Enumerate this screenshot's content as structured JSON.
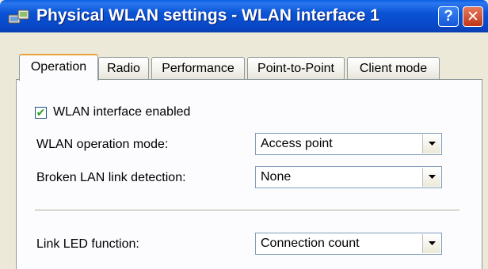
{
  "window": {
    "title": "Physical WLAN settings - WLAN interface 1",
    "help_label": "?",
    "close_label": "✕"
  },
  "tabs": [
    {
      "label": "Operation",
      "active": true
    },
    {
      "label": "Radio",
      "active": false
    },
    {
      "label": "Performance",
      "active": false
    },
    {
      "label": "Point-to-Point",
      "active": false
    },
    {
      "label": "Client mode",
      "active": false
    }
  ],
  "operation": {
    "wlan_enabled": {
      "label": "WLAN interface enabled",
      "checked": true,
      "mark": "✔"
    },
    "operation_mode": {
      "label": "WLAN operation mode:",
      "value": "Access point"
    },
    "broken_link": {
      "label": "Broken LAN link detection:",
      "value": "None"
    },
    "link_led": {
      "label": "Link LED function:",
      "value": "Connection count"
    }
  }
}
